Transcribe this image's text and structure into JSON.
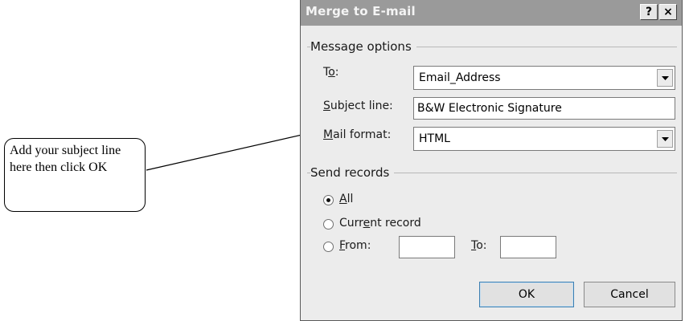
{
  "callout": {
    "text": "Add your subject line here then click OK"
  },
  "dialog": {
    "title": "Merge to E-mail",
    "help_label": "?",
    "close_label": "×",
    "message_options": {
      "group_label": "Message options",
      "to": {
        "label_pre": "T",
        "label_u": "o",
        "label_post": ":",
        "value": "Email_Address"
      },
      "subject": {
        "label_u": "S",
        "label_post": "ubject line:",
        "value": "B&W Electronic Signature"
      },
      "mail_format": {
        "label_u": "M",
        "label_post": "ail format:",
        "value": "HTML"
      }
    },
    "send_records": {
      "group_label": "Send records",
      "all": {
        "label_u": "A",
        "label_post": "ll",
        "selected": true
      },
      "current": {
        "label_pre": "Curr",
        "label_u": "e",
        "label_post": "nt record",
        "selected": false
      },
      "from": {
        "label_u": "F",
        "label_post": "rom:",
        "selected": false,
        "value": ""
      },
      "to": {
        "label_u": "T",
        "label_post": "o:",
        "value": ""
      }
    },
    "ok_label": "OK",
    "cancel_label": "Cancel"
  }
}
